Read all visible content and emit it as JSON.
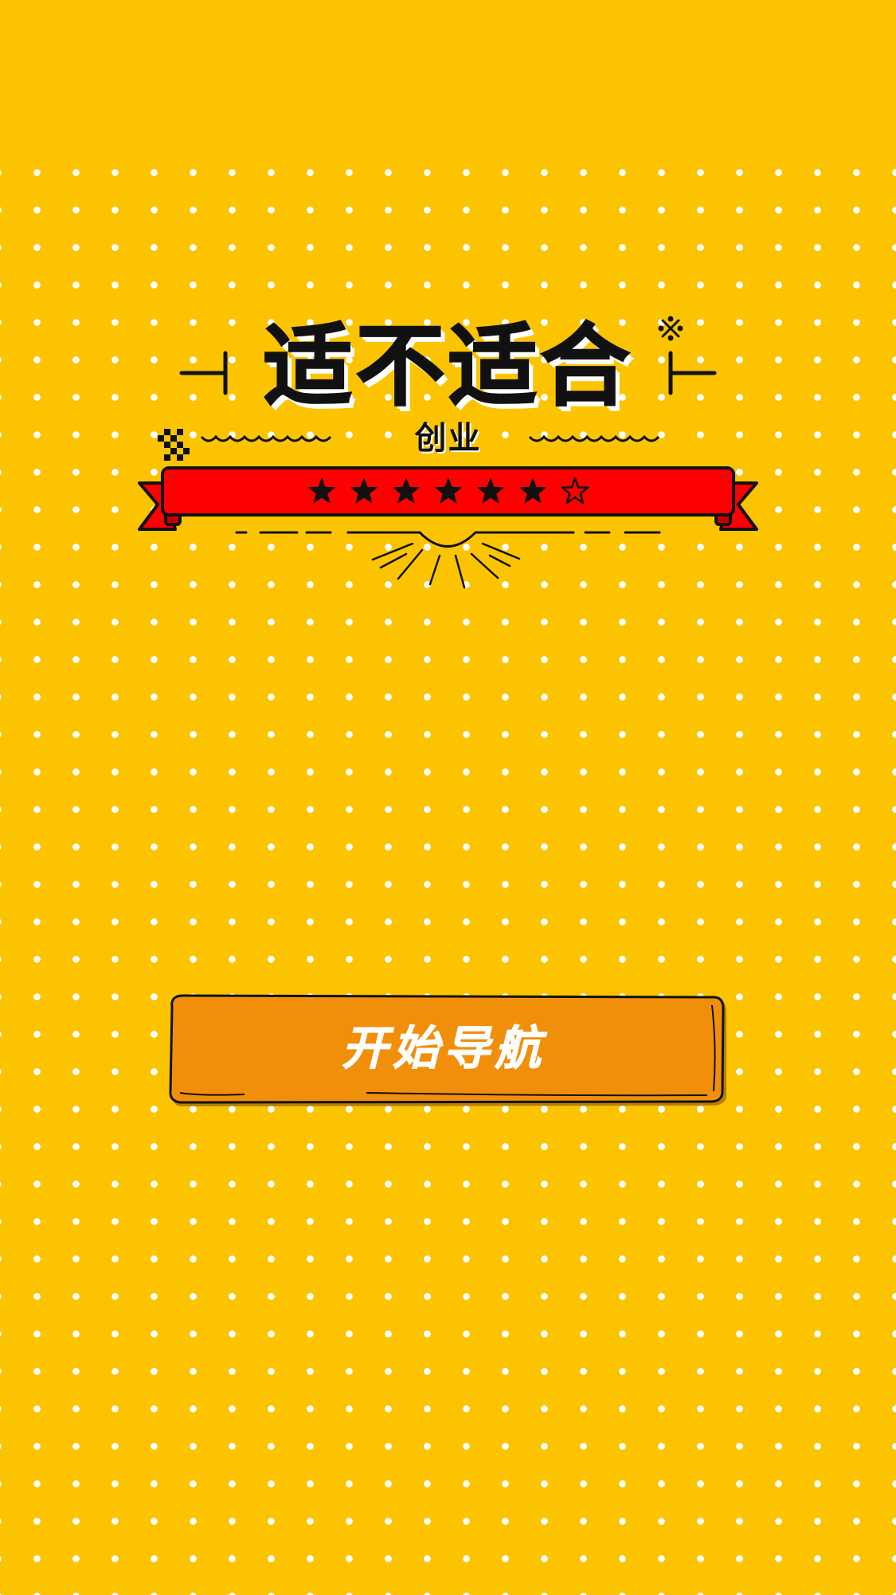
{
  "page": {
    "background_color": "#FCC400",
    "dot_color": "#FFFFFF"
  },
  "header": {
    "title": "适不适合",
    "subtitle": "创业"
  },
  "rating": {
    "filled_stars": 6,
    "total_stars": 7,
    "ribbon_color": "#FF0000"
  },
  "actions": {
    "start_label": "开始导航",
    "button_color": "#F18F0A"
  },
  "icons": {
    "sparkle": "asterisk-sparkle-icon",
    "checker": "checker-pattern-icon",
    "star_filled": "star-filled-icon",
    "star_empty": "star-outline-icon"
  }
}
